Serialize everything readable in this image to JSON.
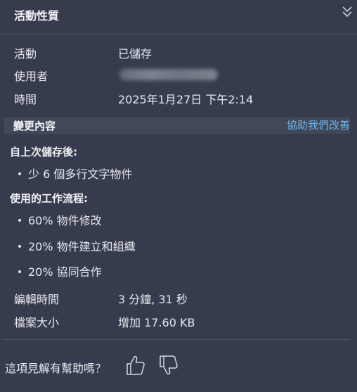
{
  "header": {
    "title": "活動性質"
  },
  "info": {
    "activity_label": "活動",
    "activity_value": "已儲存",
    "user_label": "使用者",
    "time_label": "時間",
    "time_value": "2025年1月27日 下午2:14"
  },
  "changes": {
    "title": "變更內容",
    "help_link": "協助我們改善",
    "since_last_save_heading": "自上次儲存後:",
    "since_last_save_items": [
      "少 6 個多行文字物件"
    ],
    "workflow_heading": "使用的工作流程:",
    "workflow_items": [
      "60% 物件修改",
      "20% 物件建立和組織",
      "20% 協同合作"
    ],
    "edit_time_label": "編輯時間",
    "edit_time_value": "3 分鐘, 31 秒",
    "file_size_label": "檔案大小",
    "file_size_value": "增加 17.60 KB"
  },
  "feedback": {
    "question": "這項見解有幫助嗎？"
  },
  "icons": {
    "collapse": "double-chevron-down-icon",
    "thumbs_up": "thumbs-up-icon",
    "thumbs_down": "thumbs-down-icon"
  }
}
